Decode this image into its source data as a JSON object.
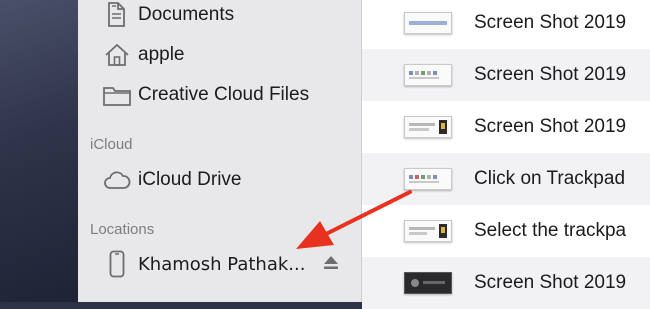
{
  "sidebar": {
    "favorites": [
      {
        "label": "Documents",
        "icon": "document-icon"
      },
      {
        "label": "apple",
        "icon": "home-icon"
      },
      {
        "label": "Creative Cloud Files",
        "icon": "folder-icon"
      }
    ],
    "icloud_header": "iCloud",
    "icloud_items": [
      {
        "label": "iCloud Drive",
        "icon": "cloud-icon"
      }
    ],
    "locations_header": "Locations",
    "locations_items": [
      {
        "label": "Khamosh Pathak...",
        "icon": "iphone-icon",
        "action_icon": "eject-icon"
      }
    ]
  },
  "file_list": [
    {
      "name": "Screen Shot 2019"
    },
    {
      "name": "Screen Shot 2019"
    },
    {
      "name": "Screen Shot 2019"
    },
    {
      "name": "Click on Trackpad"
    },
    {
      "name": "Select the trackpa"
    },
    {
      "name": "Screen Shot 2019"
    }
  ],
  "colors": {
    "sidebar_bg": "#e8e8ea",
    "accent_arrow": "#e8321f",
    "section_header": "#7d7d82"
  }
}
